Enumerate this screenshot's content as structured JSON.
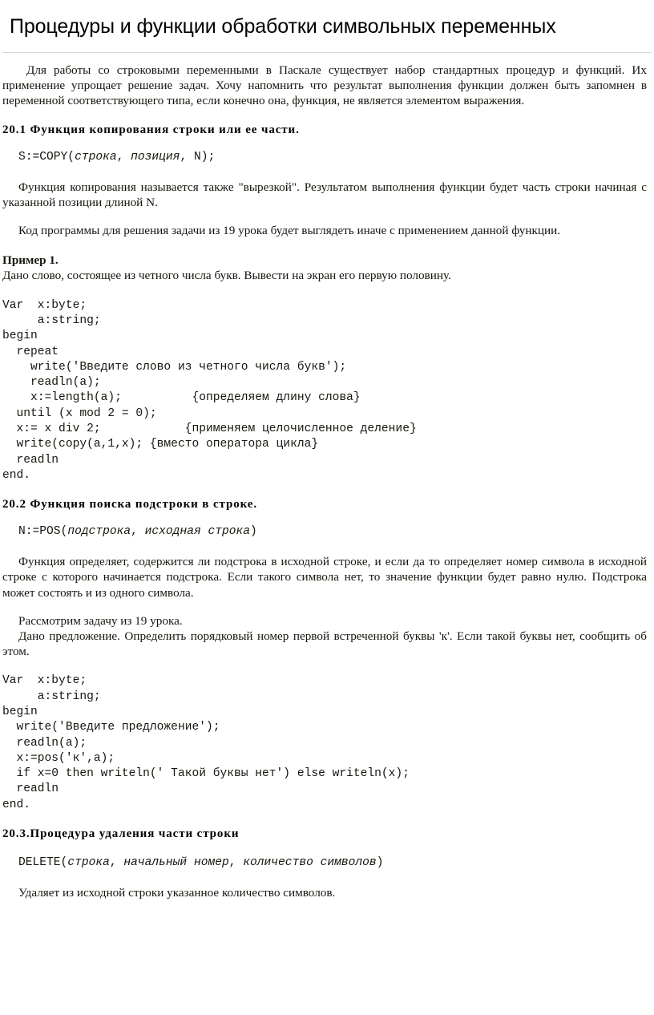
{
  "document": {
    "title": "Процедуры и функции обработки символьных переменных",
    "intro": "Для работы со строковыми переменными в Паскале существует набор стандартных процедур и функций. Их применение упрощает решение задач. Хочу напомнить что результат выполнения функции должен быть запомнен в переменной соответствующего типа, если конечно она, функция, не является элементом выражения."
  },
  "sections": {
    "copy": {
      "heading": "20.1 Функция копирования строки или ее части.",
      "signature": {
        "prefix": "S:=COPY(",
        "arg1": "строка",
        "sep1": ", ",
        "arg2": "позиция",
        "suffix": ", N);"
      },
      "description": "Функция копирования называется также \"вырезкой\". Результатом выполнения функции будет часть строки начиная с указанной позиции длиной N.",
      "note": "Код программы для решения задачи из 19 урока будет выглядеть иначе с применением данной функции.",
      "example_label": "Пример 1.",
      "example_text": "Дано слово, состоящее из четного числа букв. Вывести на экран его первую половину.",
      "code": "Var  x:byte;\n     a:string;\nbegin\n  repeat\n    write('Введите слово из четного числа букв');\n    readln(a);\n    x:=length(a);          {определяем длину слова}\n  until (x mod 2 = 0);\n  x:= x div 2;            {применяем целочисленное деление}\n  write(copy(a,1,x); {вместо оператора цикла}\n  readln\nend."
    },
    "pos": {
      "heading": "20.2 Функция поиска подстроки в строке.",
      "signature": {
        "prefix": "N:=POS(",
        "arg1": "подстрока",
        "sep1": ", ",
        "arg2": "исходная строка",
        "suffix": ")"
      },
      "description": "Функция определяет, содержится ли подстрока в исходной строке, и если да то определяет номер символа в исходной строке с которого начинается подстрока. Если такого символа нет, то значение функции будет равно нулю. Подстрока может состоять и из одного символа.",
      "task_intro": "Рассмотрим задачу из 19 урока.",
      "task_text": "Дано предложение. Определить порядковый номер первой встреченной буквы 'к'. Если такой буквы нет, сообщить об этом.",
      "code": "Var  x:byte;\n     a:string;\nbegin\n  write('Введите предложение');\n  readln(a);\n  x:=pos('к',a);\n  if x=0 then writeln(' Такой буквы нет') else writeln(x);\n  readln\nend."
    },
    "delete": {
      "heading": "20.3.Процедура удаления части строки",
      "signature": {
        "prefix": "DELETE(",
        "arg1": "строка",
        "sep1": ", ",
        "arg2": "начальный номер",
        "sep2": ", ",
        "arg3": "количество символов",
        "suffix": ")"
      },
      "description": "Удаляет из исходной строки указанное количество символов."
    }
  }
}
